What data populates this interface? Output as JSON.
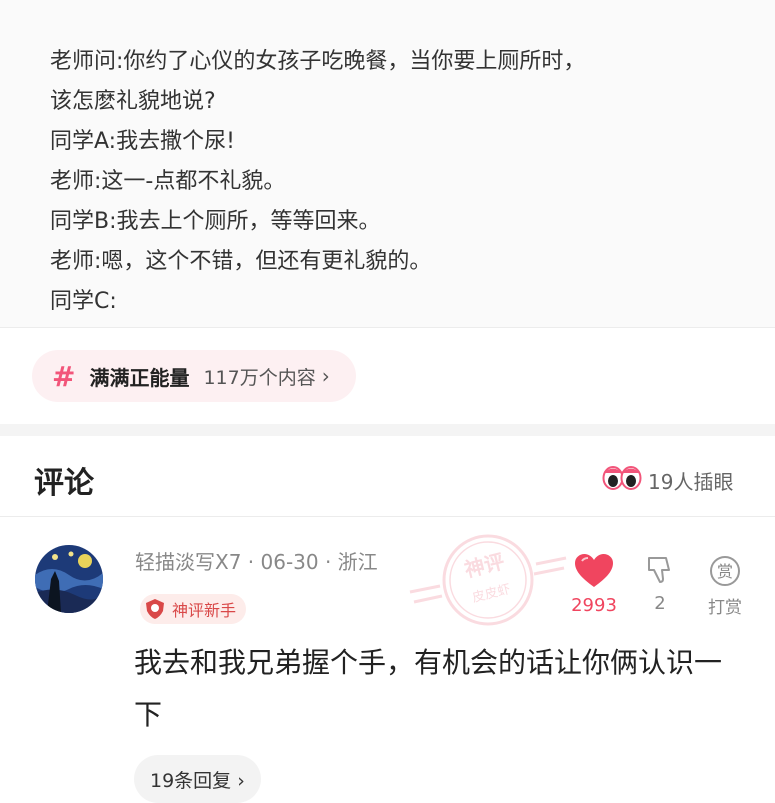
{
  "post": {
    "lines": [
      "老师问:你约了心仪的女孩子吃晚餐，当你要上厕所时，",
      "该怎麽礼貌地说?",
      "同学A:我去撒个尿!",
      "老师:这一-点都不礼貌。",
      "同学B:我去上个厕所，等等回来。",
      "老师:嗯，这个不错，但还有更礼貌的。",
      "同学C:"
    ]
  },
  "topic": {
    "hash": "#",
    "name": "满满正能量",
    "count": "117万个内容",
    "chevron": "›"
  },
  "comments_header": {
    "title": "评论",
    "icon": "eyes-icon",
    "watch_count": "19人插眼"
  },
  "comment": {
    "author_line": "轻描淡写X7 · 06-30 · 浙江",
    "badge": "神评新手",
    "stamp_top": "神评",
    "stamp_bottom": "皮皮虾",
    "likes": "2993",
    "dislikes": "2",
    "reward_glyph": "赏",
    "reward_label": "打赏",
    "text": "我去和我兄弟握个手，有机会的话让你俩认识一下",
    "replies": "19条回复 ›"
  },
  "colors": {
    "accent_pink": "#f2557a",
    "like_red": "#f0455f",
    "badge_red": "#d94848"
  }
}
